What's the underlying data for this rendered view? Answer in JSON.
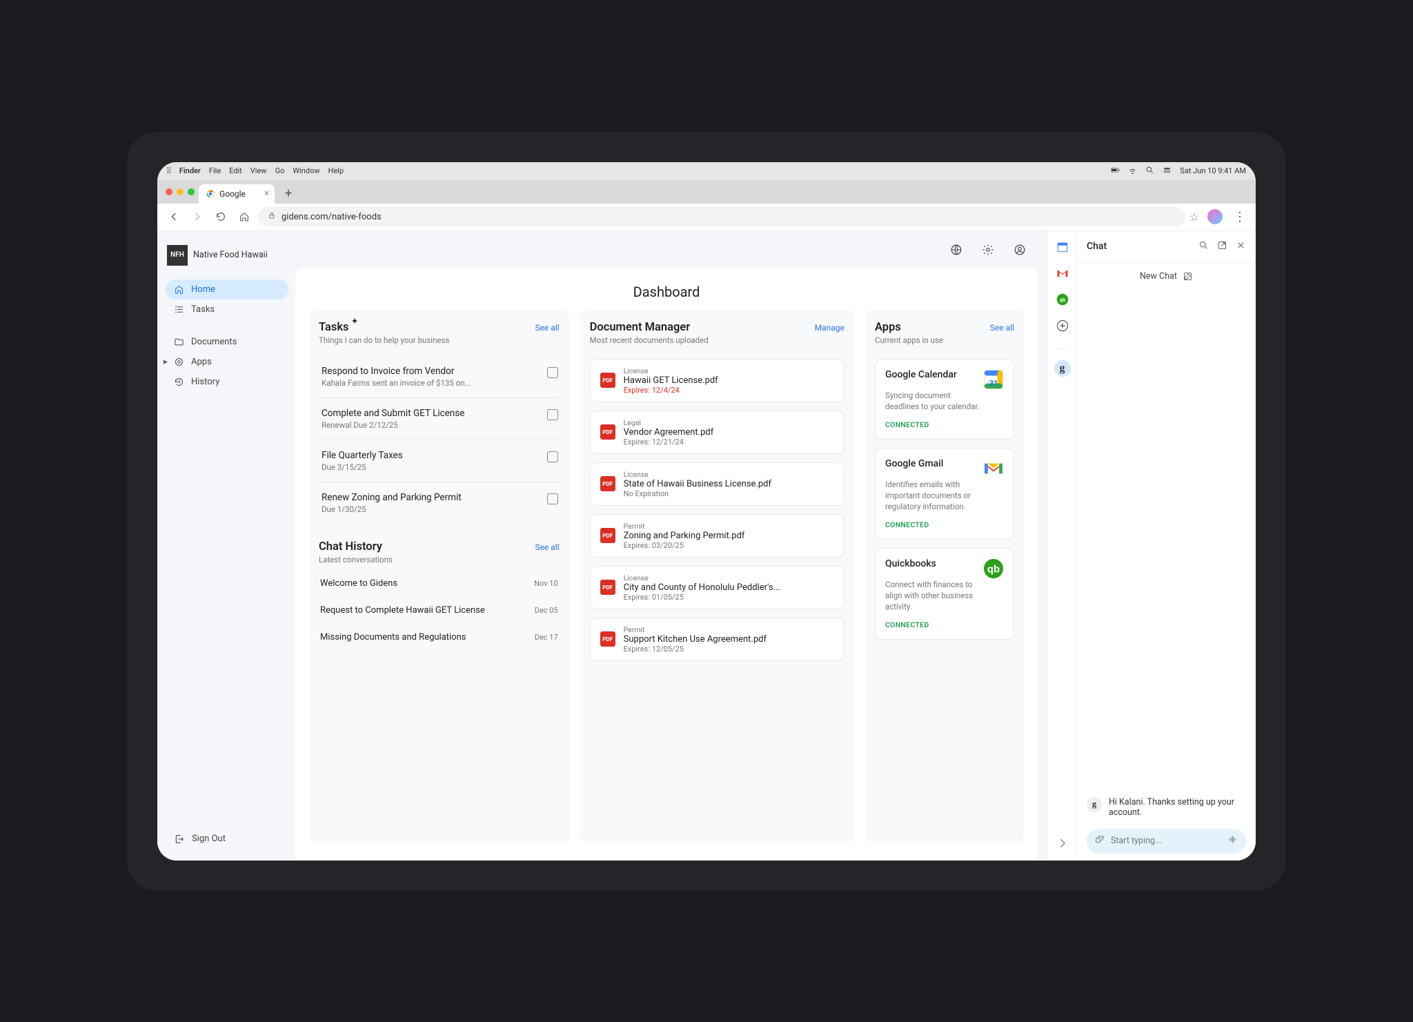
{
  "menubar": {
    "app": "Finder",
    "items": [
      "File",
      "Edit",
      "View",
      "Go",
      "Window",
      "Help"
    ],
    "clock": "Sat Jun 10  9:41 AM"
  },
  "browser": {
    "tab_title": "Google",
    "url": "gidens.com/native-foods"
  },
  "brand": {
    "badge": "NFH",
    "name": "Native Food Hawaii"
  },
  "nav": {
    "home": "Home",
    "tasks": "Tasks",
    "documents": "Documents",
    "apps": "Apps",
    "history": "History",
    "signout": "Sign Out"
  },
  "dashboard_title": "Dashboard",
  "tasks": {
    "title": "Tasks",
    "subtitle": "Things I can do to help your business",
    "see_all": "See all",
    "items": [
      {
        "title": "Respond to Invoice from Vendor",
        "sub": "Kahala Farms sent an invoice of $135 on..."
      },
      {
        "title": "Complete and Submit GET License",
        "sub": "Renewal Due 2/12/25"
      },
      {
        "title": "File Quarterly Taxes",
        "sub": "Due 3/15/25"
      },
      {
        "title": "Renew Zoning and Parking Permit",
        "sub": "Due 1/30/25"
      }
    ]
  },
  "chat_history": {
    "title": "Chat History",
    "subtitle": "Latest conversations",
    "see_all": "See all",
    "items": [
      {
        "title": "Welcome to Gidens",
        "date": "Nov 10"
      },
      {
        "title": "Request to Complete Hawaii GET License",
        "date": "Dec 05"
      },
      {
        "title": "Missing Documents and Regulations",
        "date": "Dec 17"
      }
    ]
  },
  "documents": {
    "title": "Document Manager",
    "subtitle": "Most recent documents uploaded",
    "manage": "Manage",
    "items": [
      {
        "cat": "License",
        "name": "Hawaii GET License.pdf",
        "exp": "Expires: 12/4/24",
        "alert": true
      },
      {
        "cat": "Legal",
        "name": "Vendor Agreement.pdf",
        "exp": "Expires: 12/21/24"
      },
      {
        "cat": "License",
        "name": "State of Hawaii Business License.pdf",
        "exp": "No Expiration"
      },
      {
        "cat": "Permit",
        "name": "Zoning and Parking Permit.pdf",
        "exp": "Expires: 03/20/25"
      },
      {
        "cat": "License",
        "name": "City and County of Honolulu Peddler's...",
        "exp": "Expires: 01/05/25"
      },
      {
        "cat": "Permit",
        "name": "Support Kitchen Use Agreement.pdf",
        "exp": "Expires: 12/05/25"
      }
    ]
  },
  "apps": {
    "title": "Apps",
    "subtitle": "Current apps in use",
    "see_all": "See all",
    "connected": "CONNECTED",
    "items": [
      {
        "name": "Google Calendar",
        "desc": "Syncing document deadlines to your calendar.",
        "icon": "gcal",
        "day": "31"
      },
      {
        "name": "Google Gmail",
        "desc": "Identifies emails with important documents or regulatory information.",
        "icon": "gmail"
      },
      {
        "name": "Quickbooks",
        "desc": "Connect with finances to align with other business activity.",
        "icon": "qb"
      }
    ]
  },
  "chat": {
    "title": "Chat",
    "new_chat": "New Chat",
    "greeting": "Hi Kalani. Thanks setting up your account.",
    "placeholder": "Start typing..."
  },
  "icons": {
    "pdf": "PDF"
  }
}
